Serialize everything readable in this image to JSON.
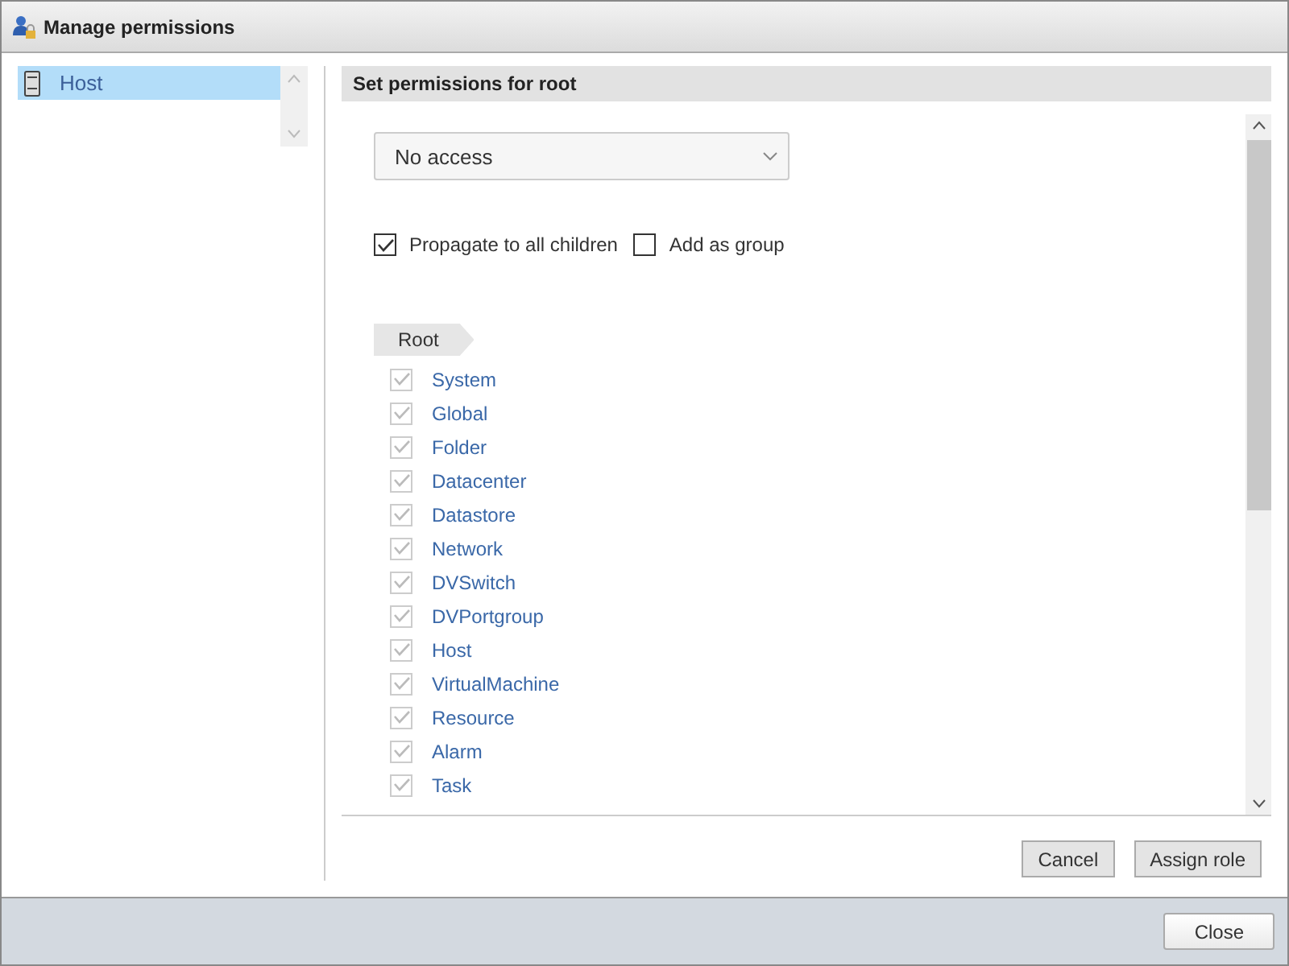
{
  "window": {
    "title": "Manage permissions"
  },
  "sidebar": {
    "items": [
      {
        "label": "Host",
        "selected": true
      }
    ]
  },
  "panel": {
    "title": "Set permissions for root",
    "role_select": {
      "value": "No access"
    },
    "options": [
      {
        "label": "Propagate to all children",
        "checked": true
      },
      {
        "label": "Add as group",
        "checked": false
      }
    ],
    "breadcrumb": "Root",
    "privileges": [
      {
        "label": "System",
        "checked": true,
        "disabled": true
      },
      {
        "label": "Global",
        "checked": true,
        "disabled": true
      },
      {
        "label": "Folder",
        "checked": true,
        "disabled": true
      },
      {
        "label": "Datacenter",
        "checked": true,
        "disabled": true
      },
      {
        "label": "Datastore",
        "checked": true,
        "disabled": true
      },
      {
        "label": "Network",
        "checked": true,
        "disabled": true
      },
      {
        "label": "DVSwitch",
        "checked": true,
        "disabled": true
      },
      {
        "label": "DVPortgroup",
        "checked": true,
        "disabled": true
      },
      {
        "label": "Host",
        "checked": true,
        "disabled": true
      },
      {
        "label": "VirtualMachine",
        "checked": true,
        "disabled": true
      },
      {
        "label": "Resource",
        "checked": true,
        "disabled": true
      },
      {
        "label": "Alarm",
        "checked": true,
        "disabled": true
      },
      {
        "label": "Task",
        "checked": true,
        "disabled": true
      }
    ],
    "buttons": [
      "Cancel",
      "Assign role"
    ]
  },
  "footer": {
    "buttons": [
      "Close"
    ]
  }
}
